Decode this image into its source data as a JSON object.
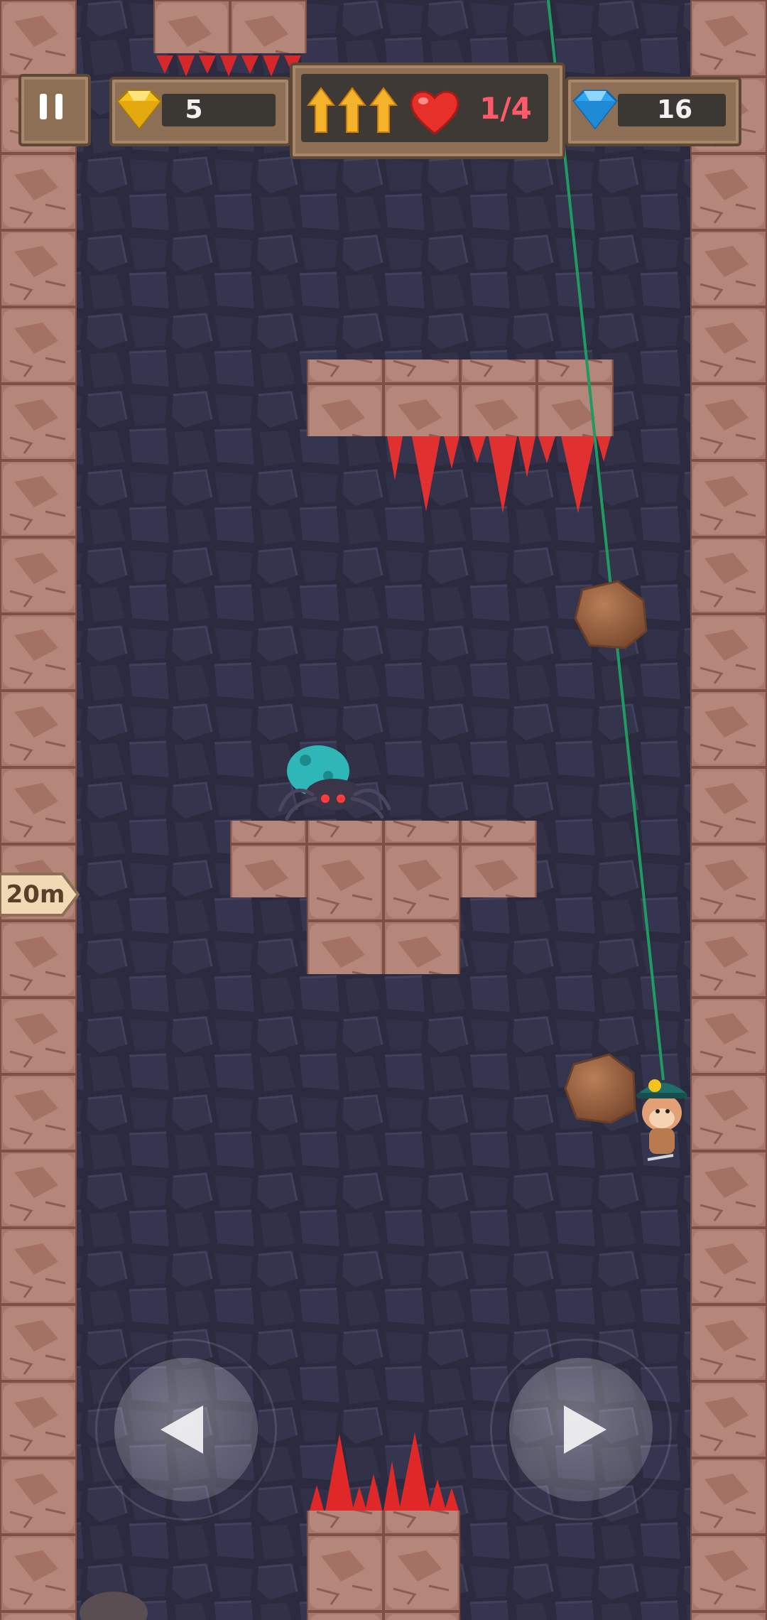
{
  "hud": {
    "gold_gems": "5",
    "lives": "1/4",
    "blue_gems": "16",
    "depth_marker": "20m"
  },
  "colors": {
    "rock": "#b07c6c",
    "rock_dark": "#8a5a4f",
    "cave_bg": "#2b2a3e",
    "spike": "#e03030",
    "rope": "#1f9a60",
    "lives_text": "#ff5a6a",
    "gold_gem": "#f4c21c",
    "blue_gem": "#2fa6f2"
  },
  "icons": {
    "pause": "pause-icon",
    "gold_gem": "gold-gem-icon",
    "blue_gem": "blue-gem-icon",
    "upgrade_arrows": "up-arrow-icon",
    "heart": "heart-icon",
    "left_control": "left-arrow-icon",
    "right_control": "right-arrow-icon"
  }
}
